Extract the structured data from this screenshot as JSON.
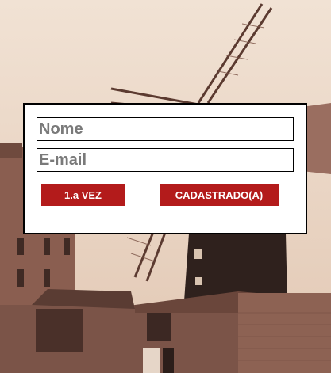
{
  "form": {
    "name_placeholder": "Nome",
    "email_placeholder": "E-mail",
    "first_time_label": "1.a VEZ",
    "registered_label": "CADASTRADO(A)"
  },
  "colors": {
    "button_bg": "#b31b1b",
    "button_text": "#ffffff",
    "card_border": "#000000",
    "photo_tint": "#ecd9c9"
  },
  "background": {
    "subject": "sepia photo of windmills and brick buildings"
  }
}
